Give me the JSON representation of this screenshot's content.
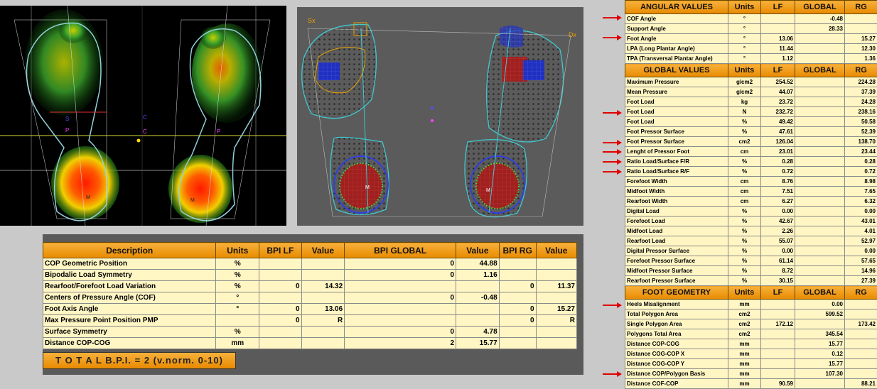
{
  "heatmap": {
    "marker_left": "M",
    "marker_right": "M",
    "labels": [
      "S",
      "P",
      "P",
      "C",
      "C"
    ]
  },
  "plantar": {
    "label_sx": "Sx",
    "label_dx": "Dx",
    "marker_left": "M",
    "marker_right": "M"
  },
  "angular": {
    "headers": [
      "ANGULAR VALUES",
      "Units",
      "LF",
      "GLOBAL",
      "RG"
    ],
    "rows": [
      [
        "COF Angle",
        "°",
        "",
        "-0.48",
        ""
      ],
      [
        "Support Angle",
        "°",
        "",
        "28.33",
        ""
      ],
      [
        "Foot Angle",
        "°",
        "13.06",
        "",
        "15.27"
      ],
      [
        "LPA (Long Plantar Angle)",
        "°",
        "11.44",
        "",
        "12.30"
      ],
      [
        "TPA (Transversal Plantar Angle)",
        "°",
        "1.12",
        "",
        "1.36"
      ]
    ]
  },
  "global": {
    "headers": [
      "GLOBAL VALUES",
      "Units",
      "LF",
      "GLOBAL",
      "RG"
    ],
    "rows": [
      [
        "Maximum Pressure",
        "g/cm2",
        "254.52",
        "",
        "224.28"
      ],
      [
        "Mean Pressure",
        "g/cm2",
        "44.07",
        "",
        "37.39"
      ],
      [
        "Foot Load",
        "kg",
        "23.72",
        "",
        "24.28"
      ],
      [
        "Foot Load",
        "N",
        "232.72",
        "",
        "238.16"
      ],
      [
        "Foot Load",
        "%",
        "49.42",
        "",
        "50.58"
      ],
      [
        "Foot Pressor Surface",
        "%",
        "47.61",
        "",
        "52.39"
      ],
      [
        "Foot Pressor Surface",
        "cm2",
        "126.04",
        "",
        "138.70"
      ],
      [
        "Lenght of Pressor Foot",
        "cm",
        "23.01",
        "",
        "23.44"
      ],
      [
        "Ratio Load/Surface F/R",
        "%",
        "0.28",
        "",
        "0.28"
      ],
      [
        "Ratio Load/Surface R/F",
        "%",
        "0.72",
        "",
        "0.72"
      ],
      [
        "Forefoot Width",
        "cm",
        "8.76",
        "",
        "8.98"
      ],
      [
        "Midfoot Width",
        "cm",
        "7.51",
        "",
        "7.65"
      ],
      [
        "Rearfoot Width",
        "cm",
        "6.27",
        "",
        "6.32"
      ],
      [
        "Digital Load",
        "%",
        "0.00",
        "",
        "0.00"
      ],
      [
        "Forefoot Load",
        "%",
        "42.67",
        "",
        "43.01"
      ],
      [
        "Midfoot Load",
        "%",
        "2.26",
        "",
        "4.01"
      ],
      [
        "Rearfoot Load",
        "%",
        "55.07",
        "",
        "52.97"
      ],
      [
        "Digital Pressor Surface",
        "%",
        "0.00",
        "",
        "0.00"
      ],
      [
        "Forefoot Pressor Surface",
        "%",
        "61.14",
        "",
        "57.65"
      ],
      [
        "Midfoot Pressor Surface",
        "%",
        "8.72",
        "",
        "14.96"
      ],
      [
        "Rearfoot Pressor Surface",
        "%",
        "30.15",
        "",
        "27.39"
      ]
    ]
  },
  "geometry": {
    "headers": [
      "FOOT GEOMETRY",
      "Units",
      "LF",
      "GLOBAL",
      "RG"
    ],
    "rows": [
      [
        "Heels Misalignment",
        "mm",
        "",
        "0.00",
        ""
      ],
      [
        "Total Polygon Area",
        "cm2",
        "",
        "599.52",
        ""
      ],
      [
        "Single Polygon Area",
        "cm2",
        "172.12",
        "",
        "173.42"
      ],
      [
        "Polygons Total Area",
        "cm2",
        "",
        "345.54",
        ""
      ],
      [
        "Distance COP-COG",
        "mm",
        "",
        "15.77",
        ""
      ],
      [
        "Distance COG-COP X",
        "mm",
        "",
        "0.12",
        ""
      ],
      [
        "Distance COG-COP Y",
        "mm",
        "",
        "15.77",
        ""
      ],
      [
        "Distance COP/Polygon Basis",
        "mm",
        "",
        "107.30",
        ""
      ],
      [
        "Distance COF-COP",
        "mm",
        "90.59",
        "",
        "88.21"
      ]
    ]
  },
  "bpi": {
    "headers": [
      "Description",
      "Units",
      "BPI LF",
      "Value",
      "BPI GLOBAL",
      "Value",
      "BPI RG",
      "Value"
    ],
    "rows": [
      [
        "COP Geometric Position",
        "%",
        "",
        "",
        "0",
        "44.88",
        "",
        ""
      ],
      [
        "Bipodalic Load Symmetry",
        "%",
        "",
        "",
        "0",
        "1.16",
        "",
        ""
      ],
      [
        "Rearfoot/Forefoot Load Variation",
        "%",
        "0",
        "14.32",
        "",
        "",
        "0",
        "11.37"
      ],
      [
        "Centers of Pressure Angle (COF)",
        "°",
        "",
        "",
        "0",
        "-0.48",
        "",
        ""
      ],
      [
        "Foot Axis Angle",
        "°",
        "0",
        "13.06",
        "",
        "",
        "0",
        "15.27"
      ],
      [
        "Max Pressure Point Position PMP",
        "",
        "0",
        "R",
        "",
        "",
        "0",
        "R"
      ],
      [
        "Surface Symmetry",
        "%",
        "",
        "",
        "0",
        "4.78",
        "",
        ""
      ],
      [
        "Distance COP-COG",
        "mm",
        "",
        "",
        "2",
        "15.77",
        "",
        ""
      ]
    ],
    "total": "T O T A L   B.P.I. = 2   (v.norm. 0-10)"
  },
  "colors": {
    "header": "#f0a020",
    "row": "#fff6c4",
    "arrow": "#e00000",
    "heat_hot": "#ff2000",
    "heat_cool": "#1a8a2a"
  }
}
